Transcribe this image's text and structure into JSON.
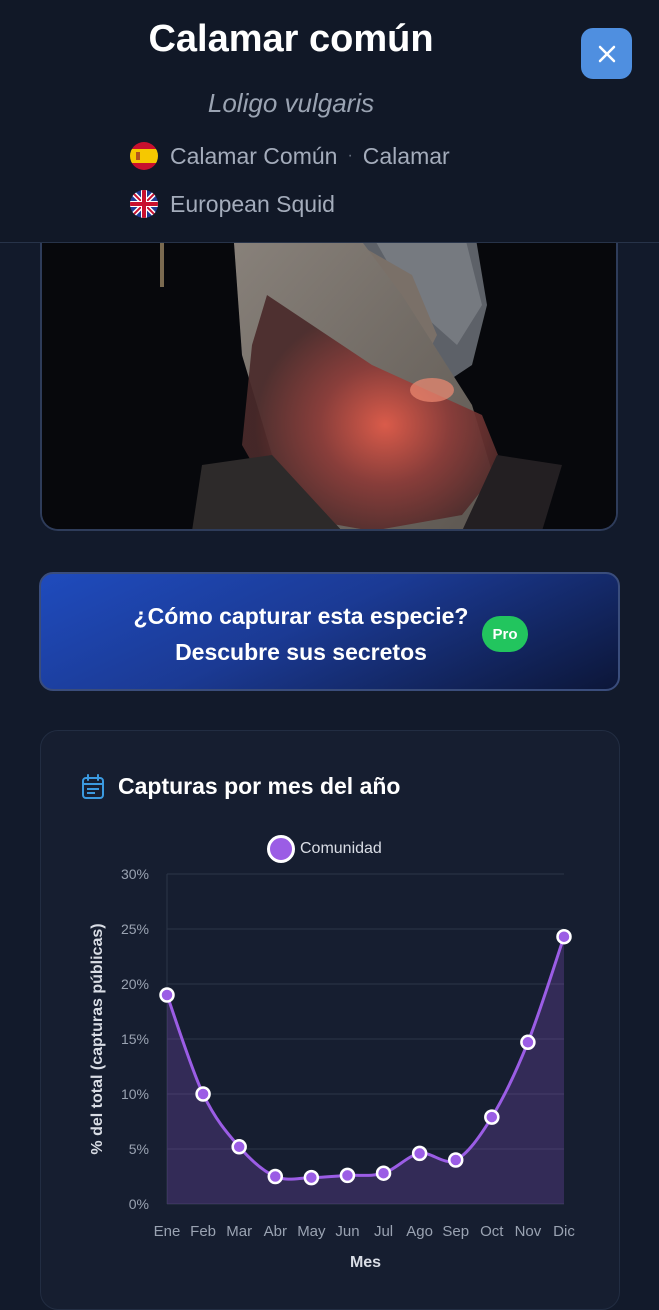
{
  "header": {
    "title": "Calamar común",
    "scientific_name": "Loligo vulgaris",
    "names": [
      {
        "flag": "spain-flag-icon",
        "names": [
          "Calamar Común",
          "Calamar"
        ]
      },
      {
        "flag": "uk-flag-icon",
        "names": [
          "European Squid"
        ]
      }
    ],
    "separator": "·",
    "close_icon": "close-icon"
  },
  "cta": {
    "line1": "¿Cómo capturar esta especie?",
    "line2": "Descubre sus secretos",
    "badge": "Pro",
    "badge_color": "#22c55e"
  },
  "chart_card": {
    "title": "Capturas por mes del año",
    "icon": "calendar-icon"
  },
  "chart_data": {
    "type": "area",
    "categories": [
      "Ene",
      "Feb",
      "Mar",
      "Abr",
      "May",
      "Jun",
      "Jul",
      "Ago",
      "Sep",
      "Oct",
      "Nov",
      "Dic"
    ],
    "series": [
      {
        "name": "Comunidad",
        "values": [
          19.0,
          10.0,
          5.2,
          2.5,
          2.4,
          2.6,
          2.8,
          4.6,
          4.0,
          7.9,
          14.7,
          24.3
        ],
        "color": "#9b5de5"
      }
    ],
    "y_ticks": [
      "0%",
      "5%",
      "10%",
      "15%",
      "20%",
      "25%",
      "30%"
    ],
    "ylim": [
      0,
      30
    ],
    "xlabel": "Mes",
    "ylabel": "% del total (capturas públicas)",
    "legend": "top",
    "grid": true
  },
  "colors": {
    "background": "#121a2b",
    "accent": "#4f8fe0",
    "series": "#9b5de5"
  }
}
